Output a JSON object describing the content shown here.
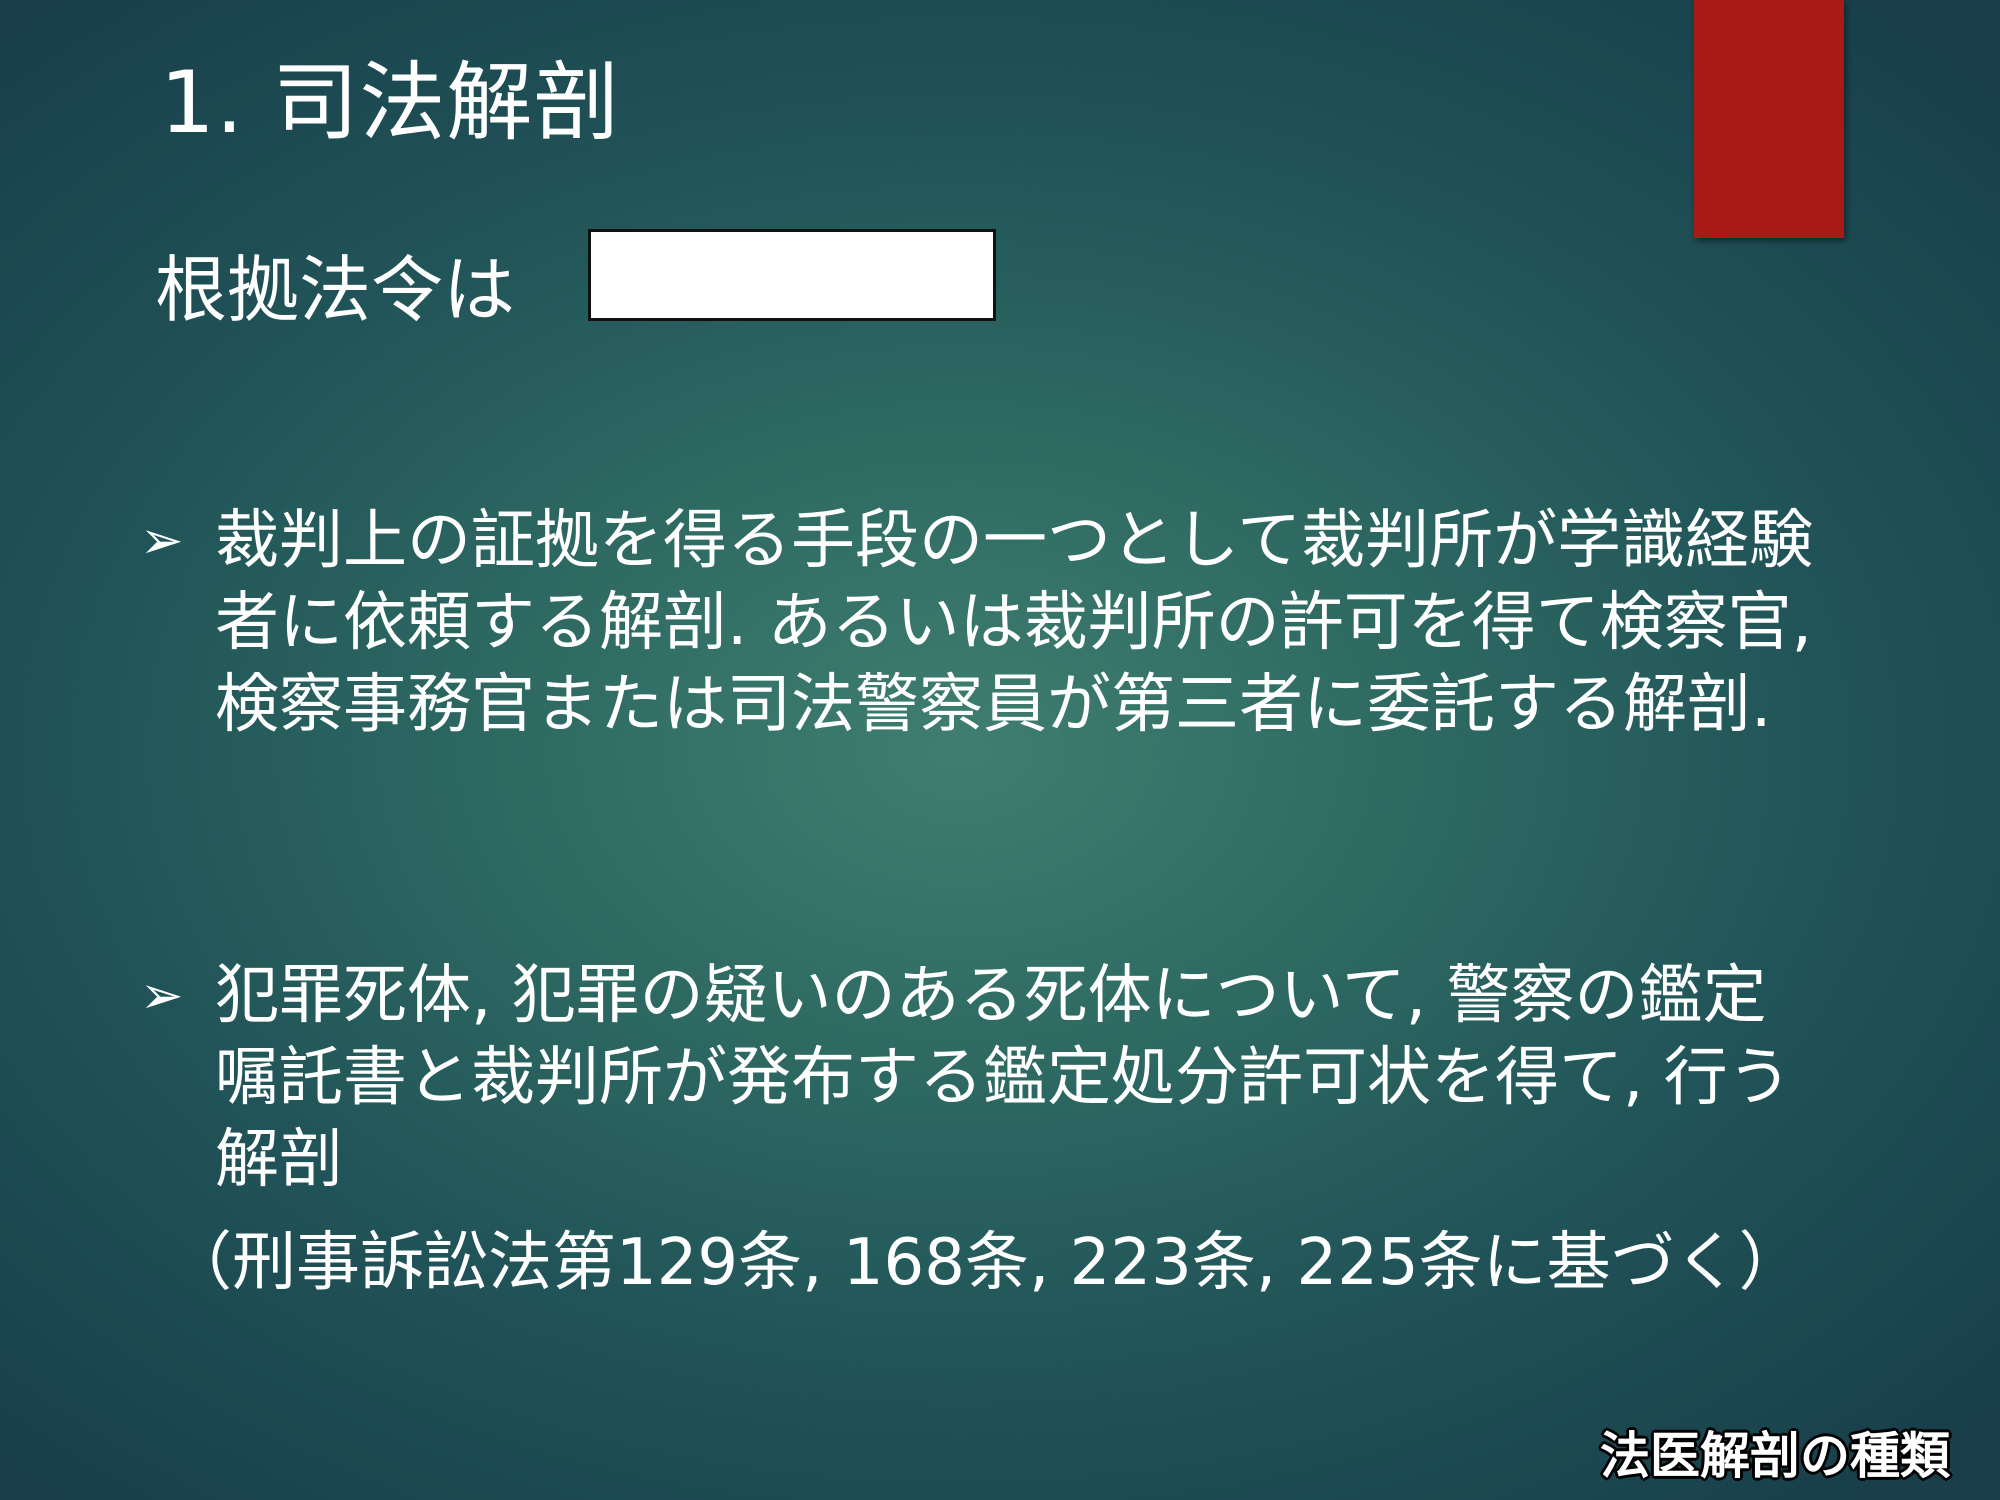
{
  "slide": {
    "title": "1. 司法解剖",
    "law_label": "根拠法令は",
    "answer_box_value": "",
    "bullets": [
      {
        "marker": "➢",
        "text": "裁判上の証拠を得る手段の一つとして裁判所が学識経験者に依頼する解剖. あるいは裁判所の許可を得て検察官, 検察事務官または司法警察員が第三者に委託する解剖."
      },
      {
        "marker": "➢",
        "text": "犯罪死体, 犯罪の疑いのある死体について, 警察の鑑定嘱託書と裁判所が発布する鑑定処分許可状を得て, 行う解剖"
      }
    ],
    "citation": "（刑事訴訟法第129条, 168条, 223条, 225条に基づく）",
    "footer_label": "法医解剖の種類"
  },
  "colors": {
    "background_center": "#3f7e70",
    "background_edge": "#183f4b",
    "accent_bar": "#a81a16",
    "text": "#ffffff",
    "answer_box": "#ffffff"
  }
}
